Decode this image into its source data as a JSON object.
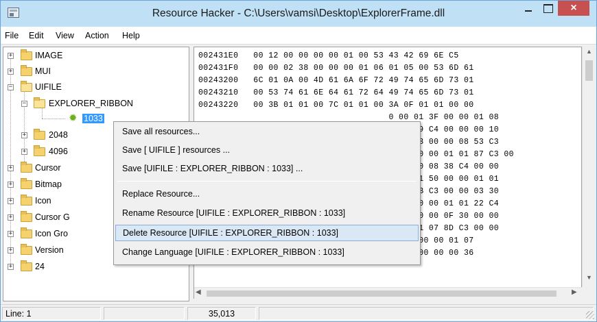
{
  "window": {
    "title": "Resource Hacker  -  C:\\Users\\vamsi\\Desktop\\ExplorerFrame.dll",
    "close_glyph": "×",
    "accent_color": "#c75050",
    "titlebar_color": "#bfe0f5"
  },
  "menubar": {
    "items": [
      "File",
      "Edit",
      "View",
      "Action",
      "Help"
    ]
  },
  "tree": {
    "nodes": [
      {
        "label": "IMAGE",
        "expander": "+",
        "icon": "folder-icon"
      },
      {
        "label": "MUI",
        "expander": "+",
        "icon": "folder-icon"
      },
      {
        "label": "UIFILE",
        "expander": "−",
        "icon": "folder-open-icon"
      },
      {
        "label": "EXPLORER_RIBBON",
        "expander": "−",
        "icon": "folder-open-icon"
      },
      {
        "label": "1033",
        "icon": "gear-icon",
        "selected": true
      },
      {
        "label": "2048",
        "expander": "+",
        "icon": "folder-icon"
      },
      {
        "label": "4096",
        "expander": "+",
        "icon": "folder-icon"
      },
      {
        "label": "Cursor",
        "expander": "+",
        "icon": "folder-icon"
      },
      {
        "label": "Bitmap",
        "expander": "+",
        "icon": "folder-icon"
      },
      {
        "label": "Icon",
        "expander": "+",
        "icon": "folder-icon"
      },
      {
        "label": "Cursor G",
        "expander": "+",
        "icon": "folder-icon"
      },
      {
        "label": "Icon Gro",
        "expander": "+",
        "icon": "folder-icon"
      },
      {
        "label": "Version",
        "expander": "+",
        "icon": "folder-icon"
      },
      {
        "label": "24",
        "expander": "+",
        "icon": "folder-icon"
      }
    ]
  },
  "hex": {
    "rows": [
      "002431E0   00 12 00 00 00 00 01 00 53 43 42 69 6E C5",
      "002431F0   00 00 02 38 00 00 00 01 06 01 05 00 53 6D 61",
      "00243200   6C 01 0A 00 4D 61 6A 6F 72 49 74 65 6D 73 01",
      "00243210   00 53 74 61 6E 64 61 72 64 49 74 65 6D 73 01",
      "00243220   00 3B 01 01 00 7C 01 01 00 3A 0F 01 01 00 00",
      "                                      0 00 01 3F 00 00 01 08",
      "                                      1 07 19 C4 00 00 00 10",
      "                                      7 00 C3 00 00 08 53 C3",
      "                                      0 00 00 00 01 01 87 C3 00",
      "                                      3 00 00 08 38 C4 00 00",
      "                                      0 00 01 50 00 00 01 01",
      "                                      1 07 8B C3 00 00 03 30",
      "                                      4 50 00 00 01 01 22 C4",
      "                                      3 C4 00 00 0F 30 00 00",
      "                                      0 00 01 07 8D C3 00 00",
      "002432D0   60 00 00 01 07 8E C3 00 00 05 30 00 00 01 07",
      "002432E0   C3 00 00 10 30 00 00 01 07 39 C4 00 00 00 36"
    ]
  },
  "context_menu": {
    "items": [
      {
        "label": "Save all resources..."
      },
      {
        "label": "Save [ UIFILE ] resources ..."
      },
      {
        "label": "Save [UIFILE : EXPLORER_RIBBON : 1033] ..."
      },
      {
        "label": "Replace Resource..."
      },
      {
        "label": "Rename Resource [UIFILE : EXPLORER_RIBBON : 1033]"
      },
      {
        "label": "Delete Resource [UIFILE : EXPLORER_RIBBON : 1033]",
        "highlighted": true
      },
      {
        "label": "Change Language [UIFILE : EXPLORER_RIBBON : 1033]"
      }
    ]
  },
  "statusbar": {
    "line": "Line: 1",
    "empty": "",
    "size": "35,013"
  }
}
